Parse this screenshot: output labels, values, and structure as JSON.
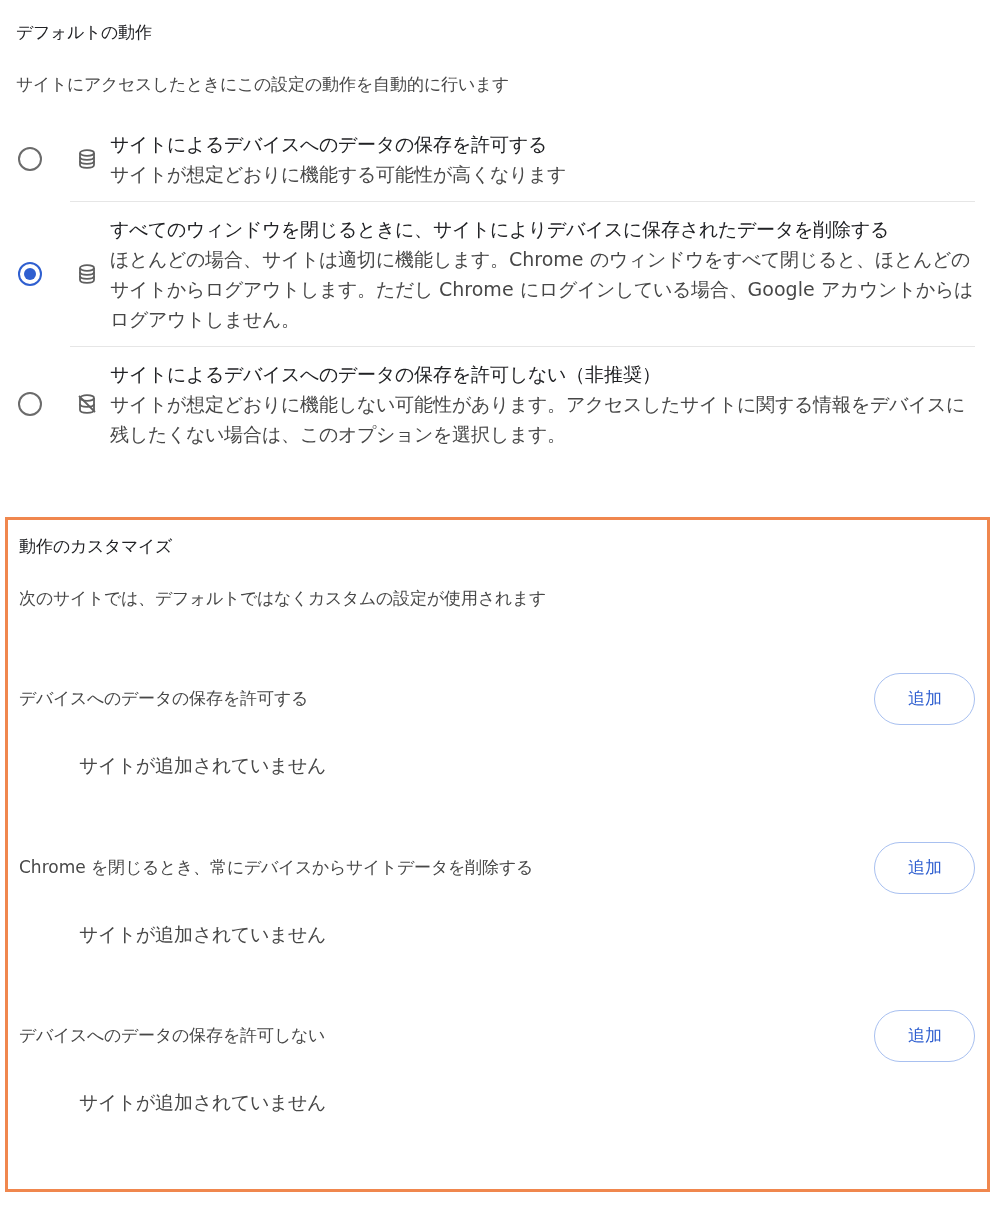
{
  "default_behavior": {
    "title": "デフォルトの動作",
    "description": "サイトにアクセスしたときにこの設定の動作を自動的に行います",
    "options": [
      {
        "label": "サイトによるデバイスへのデータの保存を許可する",
        "description": "サイトが想定どおりに機能する可能性が高くなります",
        "kind": "database",
        "selected": false
      },
      {
        "label": "すべてのウィンドウを閉じるときに、サイトによりデバイスに保存されたデータを削除する",
        "description": "ほとんどの場合、サイトは適切に機能します。Chrome のウィンドウをすべて閉じると、ほとんどのサイトからログアウトします。ただし Chrome にログインしている場合、Google アカウントからはログアウトしません。",
        "kind": "database",
        "selected": true
      },
      {
        "label": "サイトによるデバイスへのデータの保存を許可しない（非推奨）",
        "description": "サイトが想定どおりに機能しない可能性があります。アクセスしたサイトに関する情報をデバイスに残したくない場合は、このオプションを選択します。",
        "kind": "database-off",
        "selected": false
      }
    ]
  },
  "custom_behavior": {
    "highlighted": true,
    "title": "動作のカスタマイズ",
    "description": "次のサイトでは、デフォルトではなくカスタムの設定が使用されます",
    "lists": [
      {
        "heading": "デバイスへのデータの保存を許可する",
        "button": "追加",
        "empty_text": "サイトが追加されていません"
      },
      {
        "heading": "Chrome を閉じるとき、常にデバイスからサイトデータを削除する",
        "button": "追加",
        "empty_text": "サイトが追加されていません"
      },
      {
        "heading": "デバイスへのデータの保存を許可しない",
        "button": "追加",
        "empty_text": "サイトが追加されていません"
      }
    ]
  }
}
